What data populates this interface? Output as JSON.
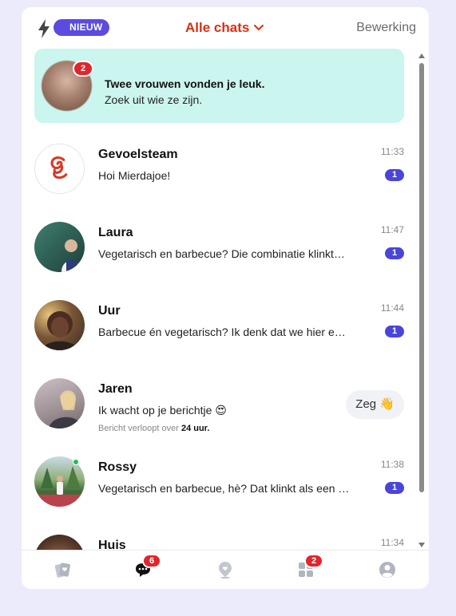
{
  "header": {
    "new_label": "NIEUW",
    "title": "Alle chats",
    "edit_label": "Bewerking"
  },
  "banner": {
    "badge": "2",
    "line1": "Twee vrouwen vonden je leuk.",
    "line2": "Zoek uit wie ze zijn."
  },
  "chats": [
    {
      "name": "Gevoelsteam",
      "message": "Hoi Mierdajoe!",
      "time": "11:33",
      "unread": "1",
      "avatar": "brand-logo"
    },
    {
      "name": "Laura",
      "message": "Vegetarisch en barbecue? Die combinatie klinkt…",
      "time": "11:47",
      "unread": "1",
      "avatar": "photo"
    },
    {
      "name": "Uur",
      "message": "Barbecue én vegetarisch? Ik denk dat we hier e…",
      "time": "11:44",
      "unread": "1",
      "avatar": "photo"
    },
    {
      "name": "Jaren",
      "message": "Ik wacht op je berichtje 😍",
      "expire_prefix": "Bericht verloopt over",
      "expire_value": "24 uur.",
      "action": "Zeg 👋",
      "avatar": "photo"
    },
    {
      "name": "Rossy",
      "message": "Vegetarisch en barbecue, hè? Dat klinkt als een …",
      "time": "11:38",
      "unread": "1",
      "avatar": "photo",
      "online": true
    },
    {
      "name": "Huis",
      "time": "11:34",
      "avatar": "photo"
    }
  ],
  "tabbar": {
    "chats_badge": "6",
    "explore_badge": "2"
  },
  "colors": {
    "accent_purple": "#5b4bde",
    "title_red": "#d92f12",
    "unread_blue": "#4a45d9",
    "banner_bg": "#cbf5ef",
    "badge_red": "#e0262c",
    "online_green": "#1fbf5a"
  }
}
